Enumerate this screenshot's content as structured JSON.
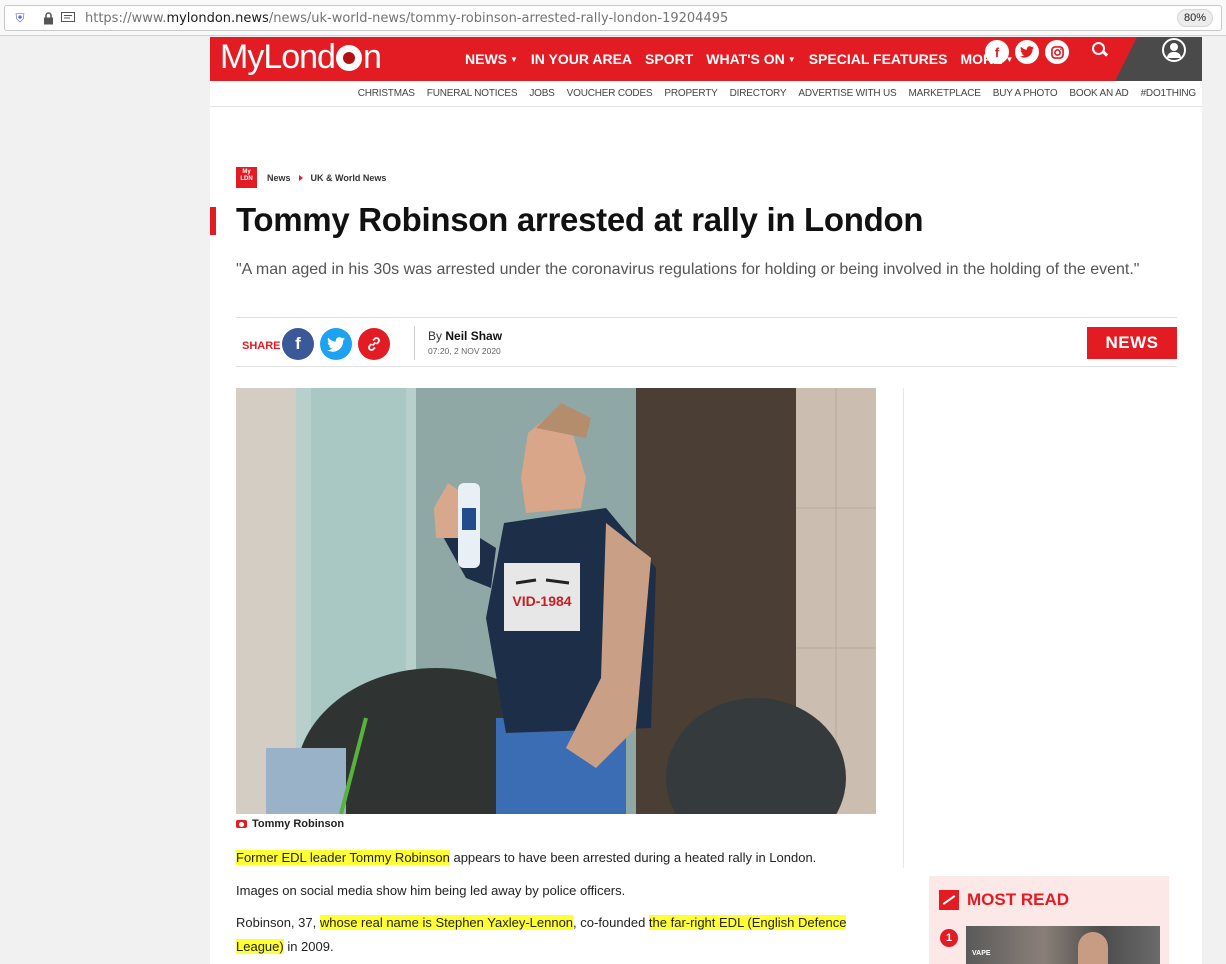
{
  "browser": {
    "url_prefix": "https://www.",
    "url_domain": "mylondon.news",
    "url_path": "/news/uk-world-news/tommy-robinson-arrested-rally-london-19204495",
    "zoom": "80%"
  },
  "site": {
    "logo_part1": "MyLond",
    "logo_part2": "n",
    "nav": [
      {
        "label": "NEWS",
        "caret": true
      },
      {
        "label": "IN YOUR AREA",
        "caret": false
      },
      {
        "label": "SPORT",
        "caret": false
      },
      {
        "label": "WHAT'S ON",
        "caret": true
      },
      {
        "label": "SPECIAL FEATURES",
        "caret": false
      },
      {
        "label": "MORE",
        "caret": true
      }
    ],
    "subnav": [
      "CHRISTMAS",
      "FUNERAL NOTICES",
      "JOBS",
      "VOUCHER CODES",
      "PROPERTY",
      "DIRECTORY",
      "ADVERTISE WITH US",
      "MARKETPLACE",
      "BUY A PHOTO",
      "BOOK AN AD",
      "#DO1THING"
    ],
    "brand_color": "#e31b23"
  },
  "article": {
    "breadcrumb_logo_top": "My",
    "breadcrumb_logo_bottom": "LDN",
    "breadcrumb": [
      "News",
      "UK & World News"
    ],
    "title": "Tommy Robinson arrested at rally in London",
    "standfirst": "\"A man aged in his 30s was arrested under the coronavirus regulations for holding or being involved in the holding of the event.\"",
    "share_label": "SHARE",
    "author_prefix": "By",
    "author": "Neil Shaw",
    "date": "07:20, 2 NOV 2020",
    "category_badge": "NEWS",
    "image_print": "VID-1984",
    "caption": "Tommy Robinson",
    "p1_hl": "Former EDL leader Tommy Robinson",
    "p1_rest": " appears to have been arrested during a heated rally in London.",
    "p2": "Images on social media show him being led away by police officers.",
    "p3_a": "Robinson, 37, ",
    "p3_hl1": "whose real name is Stephen Yaxley-Lennon",
    "p3_b": ", co-founded ",
    "p3_hl2a": "the far-right EDL (English Defence",
    "p3_hl2b": "League)",
    "p3_c": " in 2009."
  },
  "most_read": {
    "heading": "MOST READ",
    "item_number": "1",
    "thumb_text": "VAPE"
  },
  "icons": [
    "shield-icon",
    "lock-icon",
    "reader-icon",
    "facebook-icon",
    "twitter-icon",
    "instagram-icon",
    "search-icon",
    "account-icon",
    "link-icon",
    "camera-icon",
    "trending-icon"
  ]
}
